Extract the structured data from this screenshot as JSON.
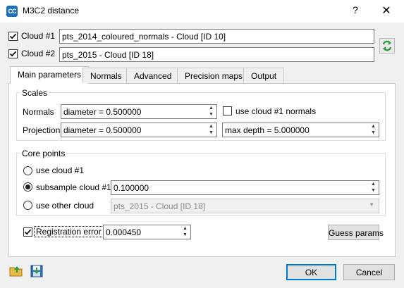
{
  "window": {
    "title": "M3C2 distance",
    "app_icon_text": "CC",
    "help_label": "?",
    "close_label": "✕"
  },
  "clouds": {
    "cloud1": {
      "label": "Cloud #1",
      "checked": true,
      "value": "pts_2014_coloured_normals - Cloud [ID 10]"
    },
    "cloud2": {
      "label": "Cloud #2",
      "checked": true,
      "value": "pts_2015 - Cloud [ID 18]"
    }
  },
  "tabs": [
    {
      "label": "Main parameters",
      "active": true
    },
    {
      "label": "Normals"
    },
    {
      "label": "Advanced"
    },
    {
      "label": "Precision maps"
    },
    {
      "label": "Output"
    }
  ],
  "scales": {
    "title": "Scales",
    "normals_label": "Normals",
    "normals_value": "diameter = 0.500000",
    "use_cloud1_normals_label": "use cloud #1 normals",
    "use_cloud1_normals_checked": false,
    "projection_label": "Projection",
    "projection_value": "diameter = 0.500000",
    "max_depth_value": "max depth = 5.000000"
  },
  "core_points": {
    "title": "Core points",
    "options": [
      {
        "label": "use cloud #1",
        "selected": false
      },
      {
        "label": "subsample cloud #1",
        "selected": true
      },
      {
        "label": "use other cloud",
        "selected": false
      }
    ],
    "subsample_value": "0.100000",
    "other_cloud_value": "pts_2015 - Cloud [ID 18]"
  },
  "registration": {
    "label": "Registration error",
    "checked": true,
    "value": "0.000450"
  },
  "buttons": {
    "guess_params": "Guess params",
    "ok": "OK",
    "cancel": "Cancel"
  },
  "icons": {
    "swap": "swap-clouds-icon",
    "load": "load-parameters-icon",
    "save": "save-parameters-icon",
    "accent": "#1c6fb8",
    "swap_color": "#2e9d3a"
  }
}
